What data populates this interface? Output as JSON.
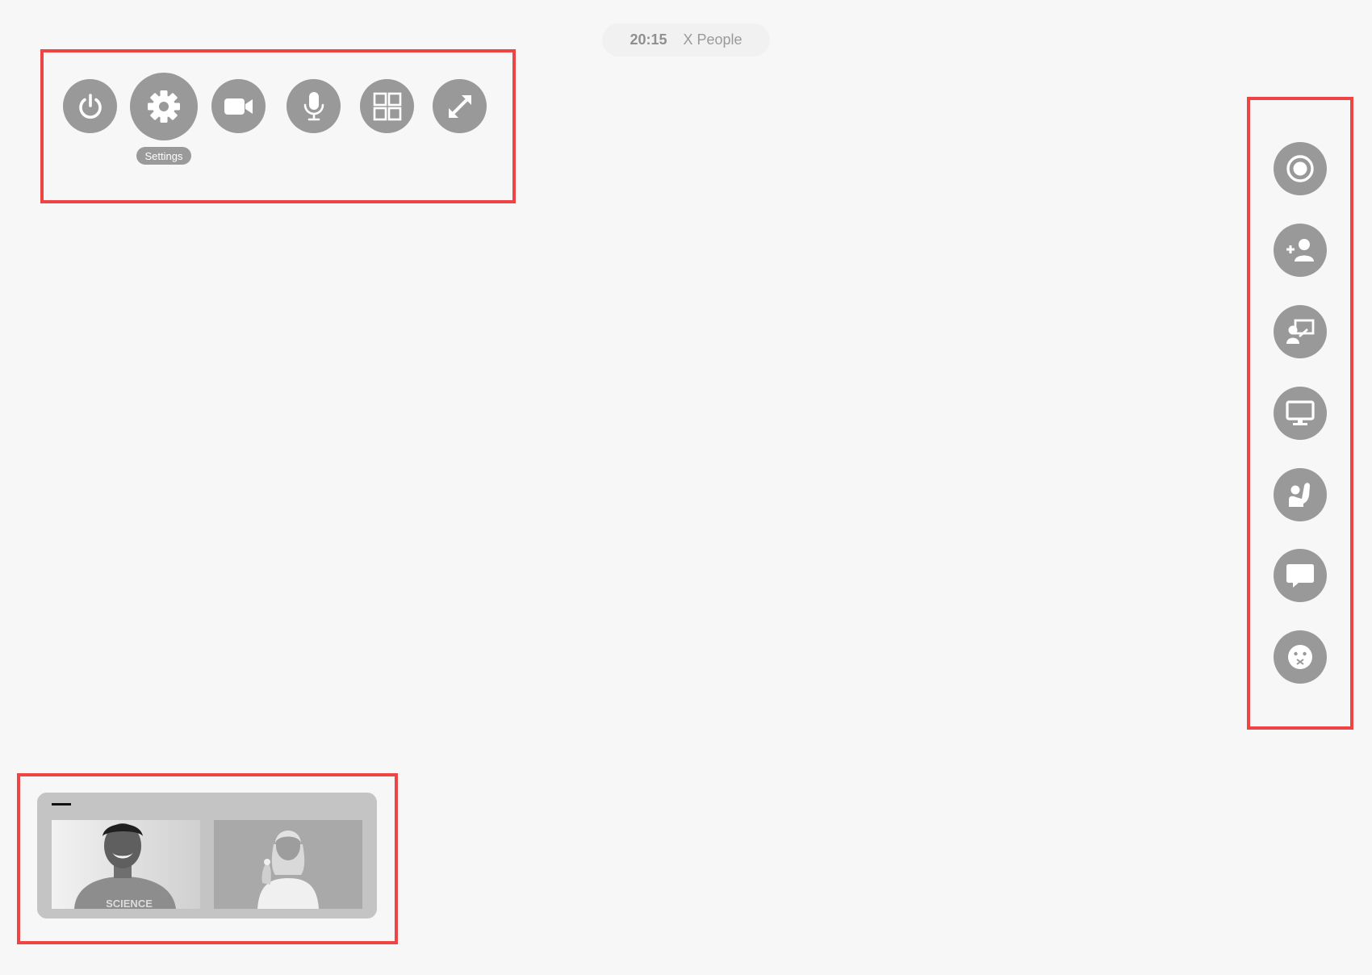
{
  "status": {
    "time": "20:15",
    "people": "X People"
  },
  "top_toolbar": {
    "buttons": [
      {
        "name": "power",
        "icon": "power-icon"
      },
      {
        "name": "settings",
        "icon": "gear-icon",
        "label": "Settings"
      },
      {
        "name": "camera",
        "icon": "video-camera-icon"
      },
      {
        "name": "microphone",
        "icon": "microphone-icon"
      },
      {
        "name": "layout-grid",
        "icon": "grid-icon"
      },
      {
        "name": "fullscreen",
        "icon": "expand-icon"
      }
    ]
  },
  "side_toolbar": {
    "buttons": [
      {
        "name": "record",
        "icon": "record-icon"
      },
      {
        "name": "add-user",
        "icon": "add-user-icon"
      },
      {
        "name": "presenter",
        "icon": "presenter-icon"
      },
      {
        "name": "screen-share",
        "icon": "monitor-icon"
      },
      {
        "name": "raise-hand",
        "icon": "raise-hand-icon"
      },
      {
        "name": "chat",
        "icon": "chat-icon"
      },
      {
        "name": "reactions",
        "icon": "emoji-icon"
      }
    ]
  },
  "participants": {
    "tiles": [
      {
        "name": "participant-1",
        "shirt_text": "SCIENCE"
      },
      {
        "name": "participant-2"
      }
    ]
  },
  "colors": {
    "background": "#f7f7f7",
    "button": "#999999",
    "icon": "#ffffff",
    "annotation": "#ef4444",
    "panel": "#c4c4c4"
  }
}
